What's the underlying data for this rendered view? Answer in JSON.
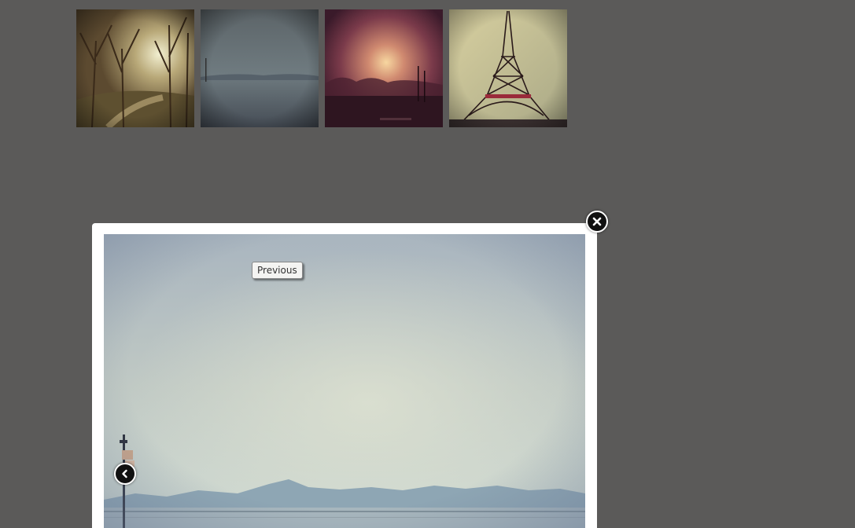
{
  "gallery": {
    "thumbnails": [
      {
        "icon": "forest-path-photo"
      },
      {
        "icon": "misty-lake-photo"
      },
      {
        "icon": "sunset-harbor-photo"
      },
      {
        "icon": "eiffel-tower-photo"
      }
    ]
  },
  "lightbox": {
    "image_icon": "lake-mountains-photo",
    "close_icon": "close-icon",
    "prev_icon": "chevron-left-icon",
    "tooltip_text": "Previous"
  },
  "colors": {
    "overlay": "#5b5a59",
    "frame": "#ffffff",
    "button": "#111111"
  }
}
